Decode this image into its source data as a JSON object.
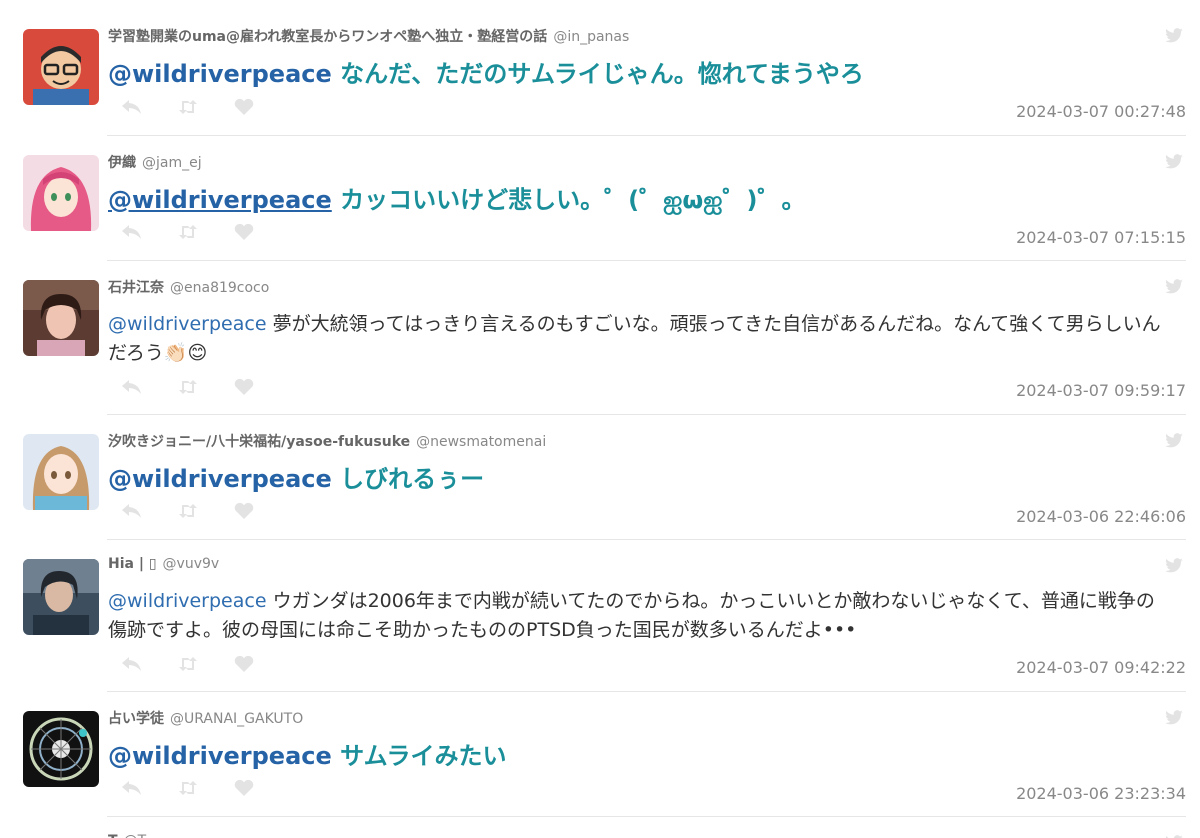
{
  "tweets": [
    {
      "name": "学習塾開業のuma@雇われ教室長からワンオペ塾へ独立・塾経営の話",
      "handle": "@in_panas",
      "mention": "@wildriverpeace",
      "text": "なんだ、ただのサムライじゃん。惚れてまうやろ",
      "time": "2024-03-07 00:27:48",
      "avatar": "cartoon-glasses-avatar"
    },
    {
      "name": "伊織",
      "handle": "@jam_ej",
      "mention": "@wildriverpeace",
      "text": "カッコいいけど悲しい。゜(゜ஐωஐ゜)゜。",
      "time": "2024-03-07 07:15:15",
      "avatar": "anime-pink-hair-avatar"
    },
    {
      "name": "石井江奈",
      "handle": "@ena819coco",
      "mention": "@wildriverpeace",
      "text": "夢が大統領ってはっきり言えるのもすごいな。頑張ってきた自信があるんだね。なんて強くて男らしいんだろう👏🏻😊",
      "time": "2024-03-07 09:59:17",
      "avatar": "photo-woman-avatar"
    },
    {
      "name": "汐吹きジョニー/八十栄福祐/yasoe-fukusuke",
      "handle": "@newsmatomenai",
      "mention": "@wildriverpeace",
      "text": "しびれるぅー",
      "time": "2024-03-06 22:46:06",
      "avatar": "anime-girl-avatar"
    },
    {
      "name": "Hia | ▯",
      "handle": "@vuv9v",
      "mention": "@wildriverpeace",
      "text": "ウガンダは2006年まで内戦が続いてたのでからね。かっこいいとか敵わないじゃなくて、普通に戦争の傷跡ですよ。彼の母国には命こそ助かったもののPTSD負った国民が数多いるんだよ•••",
      "time": "2024-03-07 09:42:22",
      "avatar": "photo-person-avatar"
    },
    {
      "name": "占い学徒",
      "handle": "@URANAI_GAKUTO",
      "mention": "@wildriverpeace",
      "text": "サムライみたい",
      "time": "2024-03-06 23:23:34",
      "avatar": "horoscope-wheel-avatar"
    }
  ],
  "partial_row": {
    "name": "T",
    "handle": "@T"
  },
  "colors": {
    "accent_text": "#1a8f9a",
    "mention": "#2563a6",
    "muted": "#888888",
    "icon": "#e3e3e3"
  },
  "icons": {
    "reply": "reply-icon",
    "retweet": "retweet-icon",
    "like": "heart-icon",
    "source": "twitter-bird-icon"
  }
}
